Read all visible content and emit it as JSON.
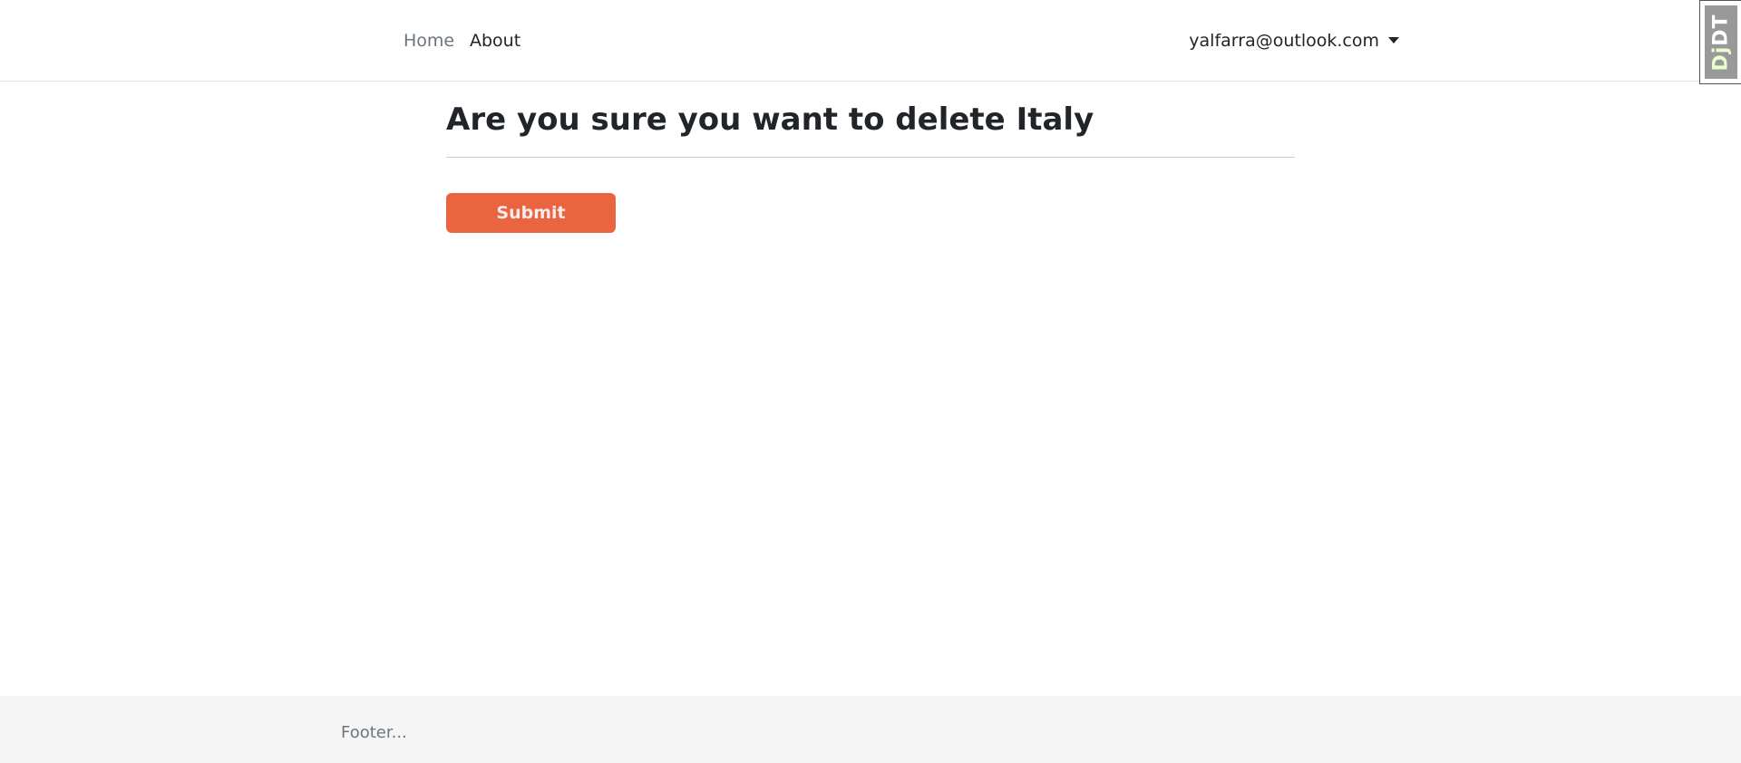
{
  "nav": {
    "home": "Home",
    "about": "About",
    "user_email": "yalfarra@outlook.com"
  },
  "debug_toolbar": {
    "label_prefix": "Dj",
    "label_suffix": "DT"
  },
  "main": {
    "title": "Are you sure you want to delete Italy",
    "submit_label": "Submit"
  },
  "colors": {
    "submit": "#ea6440"
  },
  "footer": {
    "text": "Footer..."
  }
}
